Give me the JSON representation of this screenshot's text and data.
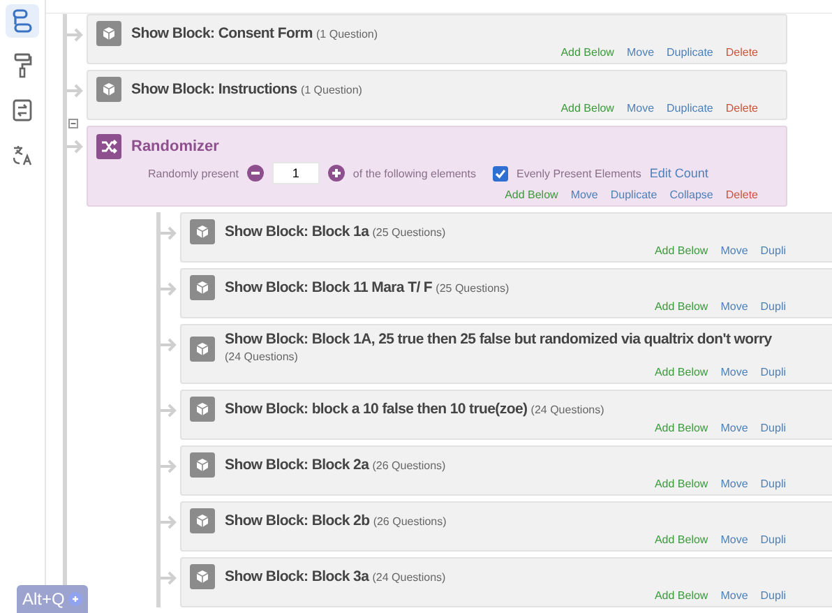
{
  "sidebar": {
    "items": [
      {
        "kind": "flow",
        "selected": true
      },
      {
        "kind": "style",
        "selected": false
      },
      {
        "kind": "options",
        "selected": false
      },
      {
        "kind": "translate",
        "selected": false
      }
    ]
  },
  "flow": [
    {
      "kind": "block",
      "title": "Show Block: Consent Form",
      "count": "(1 Question)",
      "actions": [
        {
          "label": "Add Below",
          "kind": "add"
        },
        {
          "label": "Move",
          "kind": "link"
        },
        {
          "label": "Duplicate",
          "kind": "link"
        },
        {
          "label": "Delete",
          "kind": "delete"
        }
      ]
    },
    {
      "kind": "block",
      "title": "Show Block: Instructions",
      "count": "(1 Question)",
      "actions": [
        {
          "label": "Add Below",
          "kind": "add"
        },
        {
          "label": "Move",
          "kind": "link"
        },
        {
          "label": "Duplicate",
          "kind": "link"
        },
        {
          "label": "Delete",
          "kind": "delete"
        }
      ]
    },
    {
      "kind": "randomizer",
      "title": "Randomizer",
      "expanded": true,
      "present_label": "Randomly present",
      "present_value": "1",
      "present_suffix": "of the following elements",
      "evenly": {
        "label": "Evenly Present Elements",
        "checked": true
      },
      "edit_count": "Edit Count",
      "actions": [
        {
          "label": "Add Below",
          "kind": "add"
        },
        {
          "label": "Move",
          "kind": "link"
        },
        {
          "label": "Duplicate",
          "kind": "link"
        },
        {
          "label": "Collapse",
          "kind": "link"
        },
        {
          "label": "Delete",
          "kind": "delete"
        }
      ],
      "children": [
        {
          "kind": "block",
          "title": "Show Block: Block 1a",
          "count": "(25 Questions)",
          "actions": [
            {
              "label": "Add Below",
              "kind": "add"
            },
            {
              "label": "Move",
              "kind": "link"
            },
            {
              "label": "Dupli",
              "kind": "link"
            }
          ]
        },
        {
          "kind": "block",
          "title": "Show Block: Block 11 Mara T/ F",
          "count": "(25 Questions)",
          "actions": [
            {
              "label": "Add Below",
              "kind": "add"
            },
            {
              "label": "Move",
              "kind": "link"
            },
            {
              "label": "Dupli",
              "kind": "link"
            }
          ]
        },
        {
          "kind": "block",
          "title": "Show Block: Block 1A, 25 true then 25 false but randomized via qualtrix don't worry",
          "count": "(24 Questions)",
          "actions": [
            {
              "label": "Add Below",
              "kind": "add"
            },
            {
              "label": "Move",
              "kind": "link"
            },
            {
              "label": "Dupli",
              "kind": "link"
            }
          ]
        },
        {
          "kind": "block",
          "title": "Show Block: block a 10 false then 10 true(zoe)",
          "count": "(24 Questions)",
          "actions": [
            {
              "label": "Add Below",
              "kind": "add"
            },
            {
              "label": "Move",
              "kind": "link"
            },
            {
              "label": "Dupli",
              "kind": "link"
            }
          ]
        },
        {
          "kind": "block",
          "title": "Show Block: Block 2a",
          "count": "(26 Questions)",
          "actions": [
            {
              "label": "Add Below",
              "kind": "add"
            },
            {
              "label": "Move",
              "kind": "link"
            },
            {
              "label": "Dupli",
              "kind": "link"
            }
          ]
        },
        {
          "kind": "block",
          "title": "Show Block: Block 2b",
          "count": "(26 Questions)",
          "actions": [
            {
              "label": "Add Below",
              "kind": "add"
            },
            {
              "label": "Move",
              "kind": "link"
            },
            {
              "label": "Dupli",
              "kind": "link"
            }
          ]
        },
        {
          "kind": "block",
          "title": "Show Block: Block 3a",
          "count": "(24 Questions)",
          "actions": [
            {
              "label": "Add Below",
              "kind": "add"
            },
            {
              "label": "Move",
              "kind": "link"
            },
            {
              "label": "Dupli",
              "kind": "link"
            }
          ]
        }
      ]
    }
  ],
  "shortcut": {
    "label": "Alt+Q"
  }
}
